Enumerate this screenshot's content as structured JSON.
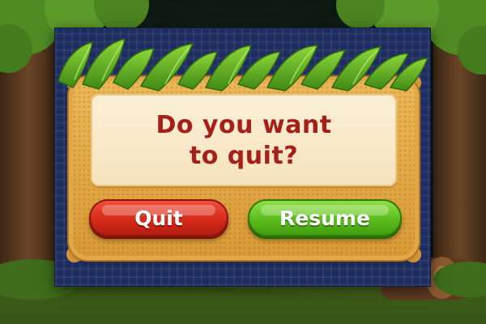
{
  "dialog": {
    "message": "Do you want\nto quit?",
    "quit_label": "Quit",
    "resume_label": "Resume"
  },
  "colors": {
    "message_text": "#a6201a",
    "quit_button": "#d62a1a",
    "resume_button": "#5cbd1d",
    "frame": "#e2a744",
    "backdrop": "#1f2f63"
  },
  "icons": [
    "leaf-decoration",
    "tree-icon",
    "log-icon"
  ]
}
